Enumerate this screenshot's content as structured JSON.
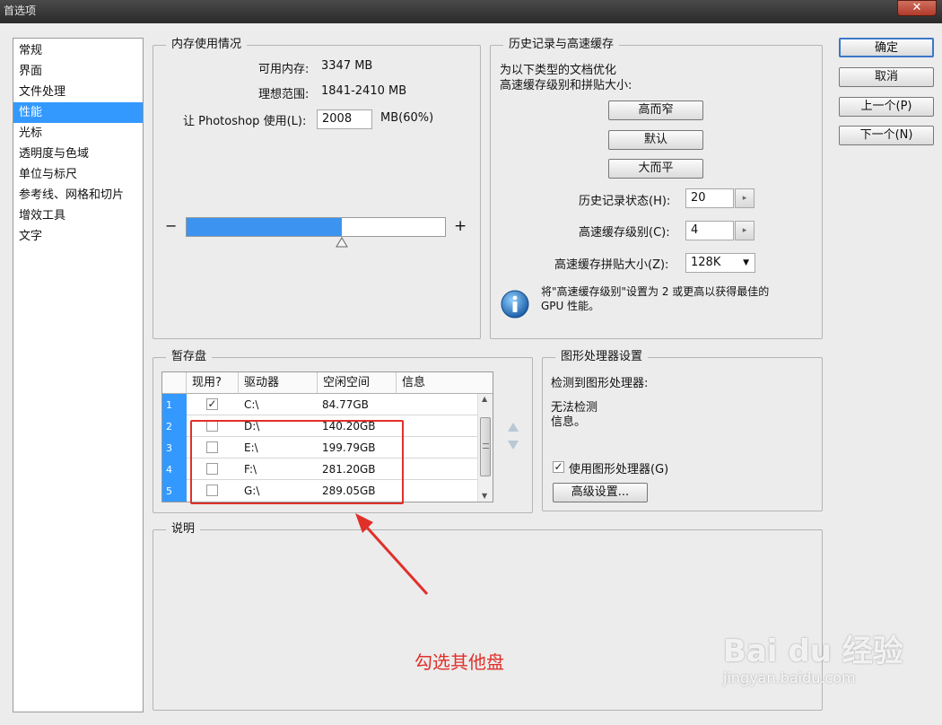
{
  "window": {
    "title": "首选项",
    "close_symbol": "✕"
  },
  "nav": {
    "items": [
      "常规",
      "界面",
      "文件处理",
      "性能",
      "光标",
      "透明度与色域",
      "单位与标尺",
      "参考线、网格和切片",
      "增效工具",
      "文字"
    ],
    "selected": "性能"
  },
  "memory": {
    "title": "内存使用情况",
    "available_label": "可用内存:",
    "available_value": "3347 MB",
    "ideal_label": "理想范围:",
    "ideal_value": "1841-2410 MB",
    "let_label": "让 Photoshop 使用(L):",
    "let_value": "2008",
    "let_unit": "MB(60%)",
    "minus": "−",
    "plus": "+",
    "slider_fraction": 0.6
  },
  "history": {
    "title": "历史记录与高速缓存",
    "desc_line1": "为以下类型的文档优化",
    "desc_line2": "高速缓存级别和拼贴大小:",
    "btn_tall_thin": "高而窄",
    "btn_default": "默认",
    "btn_big_flat": "大而平",
    "states_label": "历史记录状态(H):",
    "states_value": "20",
    "cache_levels_label": "高速缓存级别(C):",
    "cache_levels_value": "4",
    "tile_size_label": "高速缓存拼贴大小(Z):",
    "tile_size_value": "128K",
    "info_line1": "将\"高速缓存级别\"设置为 2 或更高以获得最佳的",
    "info_line2": "GPU 性能。"
  },
  "scratch": {
    "title": "暂存盘",
    "headers": [
      "现用?",
      "驱动器",
      "空闲空间",
      "信息"
    ],
    "rows": [
      {
        "num": "1",
        "active": true,
        "drive": "C:\\",
        "free": "84.77GB"
      },
      {
        "num": "2",
        "active": false,
        "drive": "D:\\",
        "free": "140.20GB"
      },
      {
        "num": "3",
        "active": false,
        "drive": "E:\\",
        "free": "199.79GB"
      },
      {
        "num": "4",
        "active": false,
        "drive": "F:\\",
        "free": "281.20GB"
      },
      {
        "num": "5",
        "active": false,
        "drive": "G:\\",
        "free": "289.05GB"
      }
    ]
  },
  "gpu": {
    "title": "图形处理器设置",
    "detected_label": "检测到图形处理器:",
    "detected_line1": "无法检测",
    "detected_line2": "信息。",
    "use_gpu_label": "使用图形处理器(G)",
    "use_gpu_checked": true,
    "advanced_btn": "高级设置..."
  },
  "description": {
    "title": "说明"
  },
  "buttons": {
    "ok": "确定",
    "cancel": "取消",
    "prev": "上一个(P)",
    "next": "下一个(N)"
  },
  "annotation": {
    "text": "勾选其他盘",
    "color": "#e0302a"
  },
  "watermark": {
    "brand": "Bai du 经验",
    "url": "jingyan.baidu.com"
  }
}
